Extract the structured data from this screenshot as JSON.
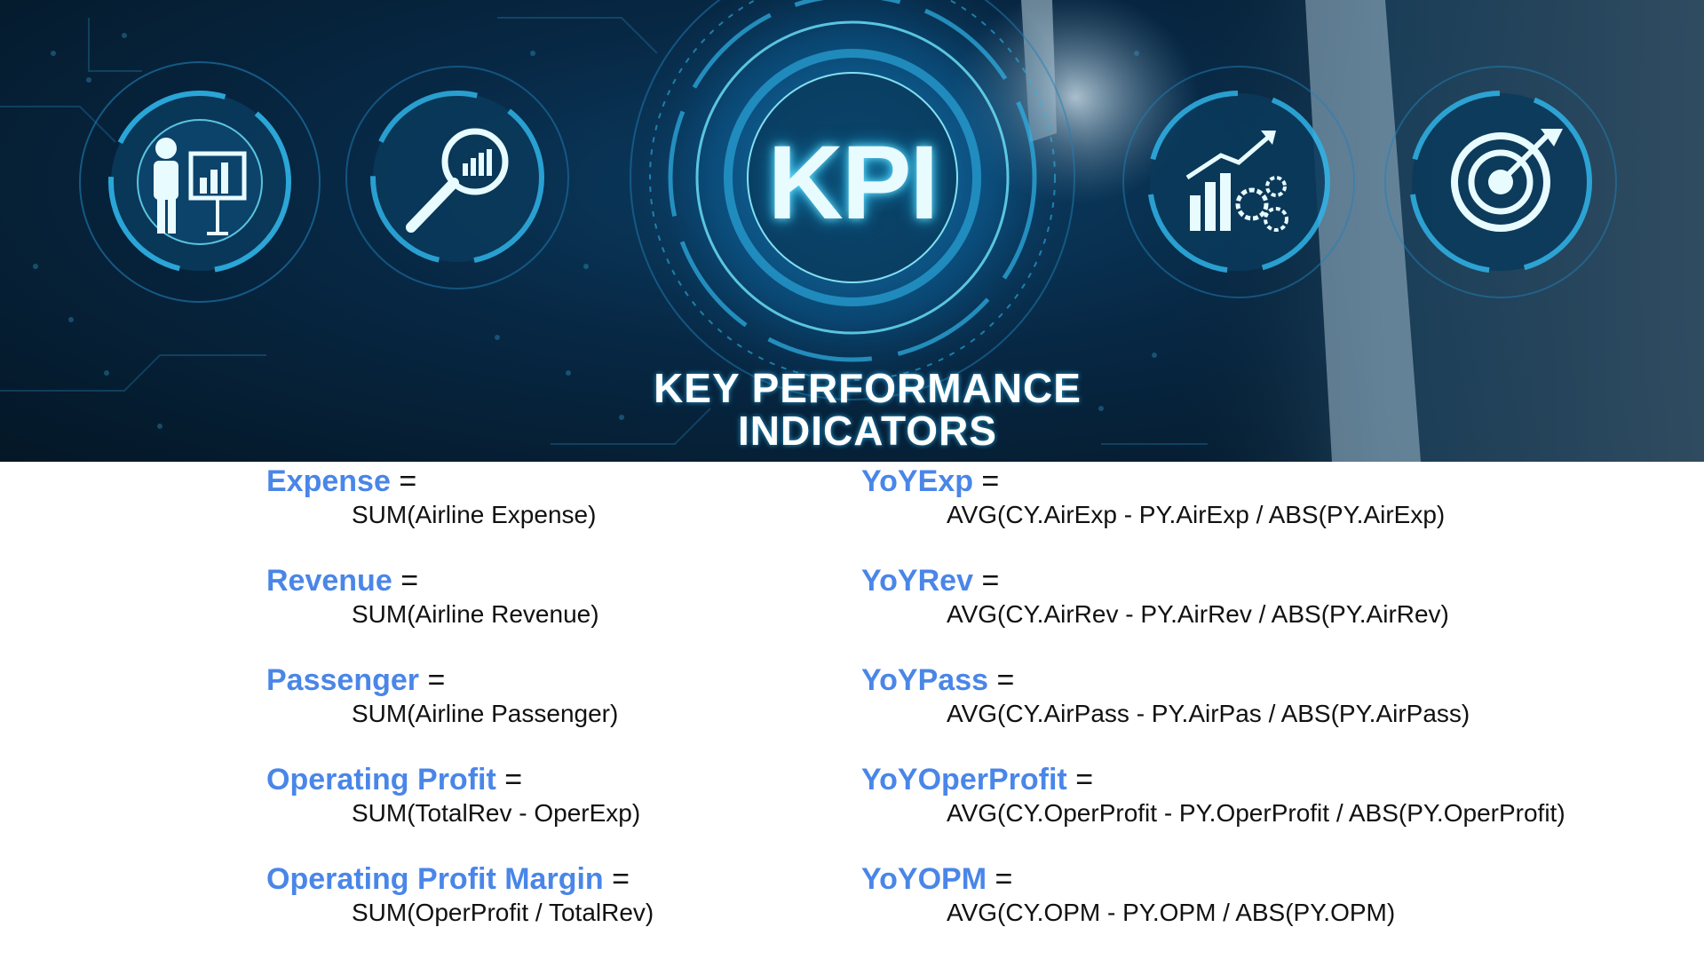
{
  "banner": {
    "logo_text": "KPI",
    "subtitle_line1": "KEY PERFORMANCE",
    "subtitle_line2": "INDICATORS",
    "icons": [
      "presenter-chart-icon",
      "magnifier-chart-icon",
      "growth-chart-gears-icon",
      "target-arrow-icon"
    ],
    "colors": {
      "accent": "#2fb4e8",
      "glow": "#6fe6ff",
      "background": "#072743"
    }
  },
  "equals_sign": "=",
  "name_color": "#4a86e8",
  "left_measures": [
    {
      "name": "Expense",
      "formula": "SUM(Airline Expense)"
    },
    {
      "name": "Revenue",
      "formula": "SUM(Airline Revenue)"
    },
    {
      "name": "Passenger",
      "formula": "SUM(Airline Passenger)"
    },
    {
      "name": "Operating Profit",
      "formula": "SUM(TotalRev - OperExp)"
    },
    {
      "name": "Operating Profit Margin",
      "formula": "SUM(OperProfit / TotalRev)"
    }
  ],
  "right_measures": [
    {
      "name": "YoYExp",
      "formula": "AVG(CY.AirExp - PY.AirExp / ABS(PY.AirExp)"
    },
    {
      "name": "YoYRev",
      "formula": "AVG(CY.AirRev - PY.AirRev / ABS(PY.AirRev)"
    },
    {
      "name": "YoYPass",
      "formula": "AVG(CY.AirPass - PY.AirPas / ABS(PY.AirPass)"
    },
    {
      "name": "YoYOperProfit",
      "formula": "AVG(CY.OperProfit - PY.OperProfit / ABS(PY.OperProfit)"
    },
    {
      "name": "YoYOPM",
      "formula": "AVG(CY.OPM - PY.OPM / ABS(PY.OPM)"
    }
  ]
}
